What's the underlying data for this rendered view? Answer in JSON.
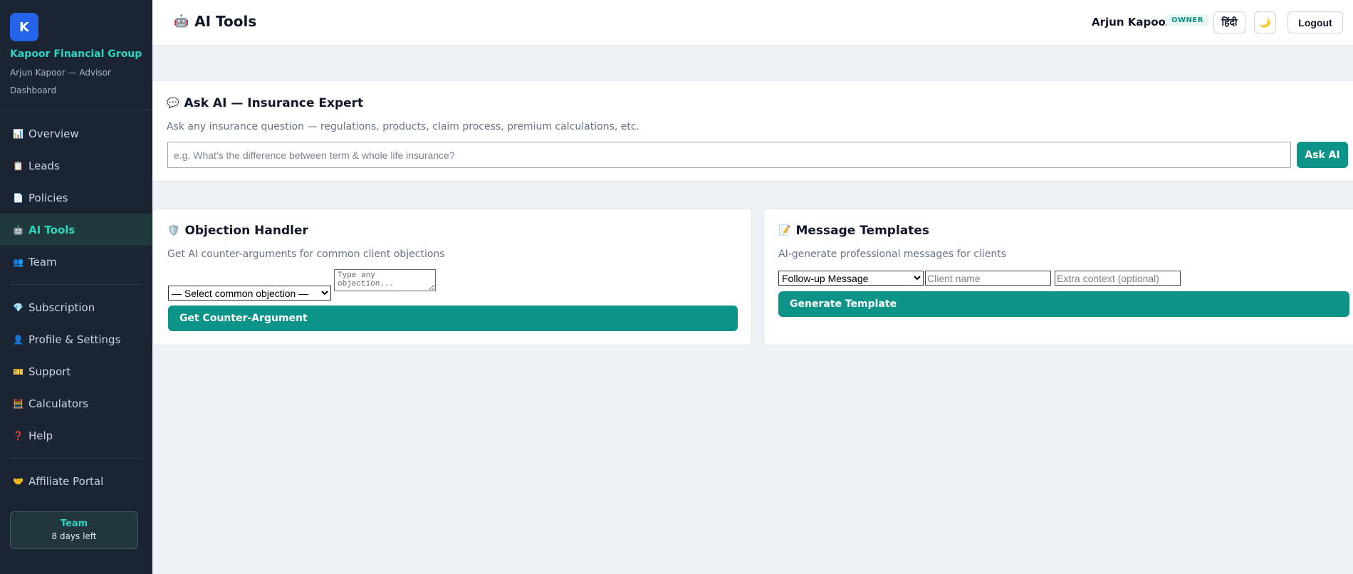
{
  "brand": {
    "logo_letter": "K",
    "name": "Kapoor Financial Group",
    "subtitle_line1": "Arjun Kapoor — Advisor",
    "subtitle_line2": "Dashboard"
  },
  "sidebar": {
    "items": [
      {
        "label": "Overview",
        "icon": "📊",
        "icon_name": "chart-icon"
      },
      {
        "label": "Leads",
        "icon": "📋",
        "icon_name": "clipboard-icon"
      },
      {
        "label": "Policies",
        "icon": "📄",
        "icon_name": "document-icon"
      },
      {
        "label": "AI Tools",
        "icon": "🤖",
        "icon_name": "robot-icon",
        "active": true
      },
      {
        "label": "Team",
        "icon": "👥",
        "icon_name": "team-icon"
      },
      {
        "label": "Subscription",
        "icon": "💎",
        "icon_name": "gem-icon"
      },
      {
        "label": "Profile & Settings",
        "icon": "👤",
        "icon_name": "user-icon"
      },
      {
        "label": "Support",
        "icon": "🎫",
        "icon_name": "ticket-icon"
      },
      {
        "label": "Calculators",
        "icon": "🧮",
        "icon_name": "calculator-icon"
      },
      {
        "label": "Help",
        "icon": "❓",
        "icon_name": "question-icon"
      },
      {
        "label": "Affiliate Portal",
        "icon": "🤝",
        "icon_name": "handshake-icon"
      }
    ],
    "plan": {
      "name": "Team",
      "days_left": "8 days left"
    }
  },
  "header": {
    "title": "AI Tools",
    "title_icon": "🤖",
    "user_name": "Arjun Kapoor",
    "role": "OWNER",
    "lang_label": "हिंदी",
    "theme_icon": "🌙",
    "logout_label": "Logout"
  },
  "ask_ai": {
    "icon": "💬",
    "title": "Ask AI — Insurance Expert",
    "description": "Ask any insurance question — regulations, products, claim process, premium calculations, etc.",
    "placeholder": "e.g. What's the difference between term & whole life insurance?",
    "button": "Ask AI"
  },
  "objection": {
    "icon": "🛡️",
    "title": "Objection Handler",
    "description": "Get AI counter-arguments for common client objections",
    "select_value": "— Select common objection —",
    "textarea_placeholder": "Type any objection...",
    "button": "Get Counter-Argument"
  },
  "templates": {
    "icon": "📝",
    "title": "Message Templates",
    "description": "AI-generate professional messages for clients",
    "select_value": "Follow-up Message",
    "client_placeholder": "Client name",
    "context_placeholder": "Extra context (optional)",
    "button": "Generate Template"
  },
  "colors": {
    "accent": "#0d9488",
    "sidebar_bg": "#1a2433",
    "brand_text": "#2dd4bf",
    "logo_bg": "#2563eb"
  }
}
